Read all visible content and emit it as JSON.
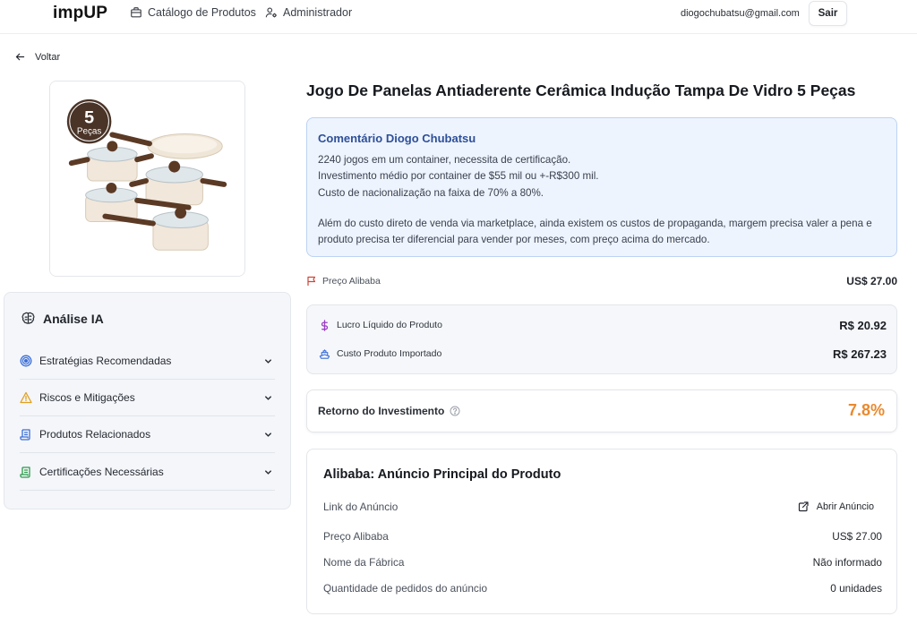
{
  "header": {
    "logo": "impUP",
    "nav": [
      {
        "label": "Catálogo de Produtos",
        "icon": "briefcase-icon"
      },
      {
        "label": "Administrador",
        "icon": "user-settings-icon"
      }
    ],
    "user_email": "diogochubatsu@gmail.com",
    "logout_label": "Sair"
  },
  "back": {
    "label": "Voltar",
    "icon": "arrow-left-icon"
  },
  "product": {
    "title": "Jogo De Panelas Antiaderente Cerâmica Indução Tampa De Vidro 5 Peças",
    "image_badge": {
      "number": "5",
      "word": "Peças"
    }
  },
  "ai_analysis": {
    "title": "Análise IA",
    "icon": "brain-icon",
    "sections": [
      {
        "label": "Estratégias Recomendadas",
        "icon": "target-icon",
        "color": "#3b6fd8"
      },
      {
        "label": "Riscos e Mitigações",
        "icon": "warning-icon",
        "color": "#e0a020"
      },
      {
        "label": "Produtos Relacionados",
        "icon": "scroll-icon",
        "color": "#3b6fd8"
      },
      {
        "label": "Certificações Necessárias",
        "icon": "scroll-icon",
        "color": "#2e9a4c"
      }
    ]
  },
  "comment": {
    "title": "Comentário Diogo Chubatsu",
    "lines": [
      "2240 jogos em um container, necessita de certificação.",
      "Investimento médio por container de $55 mil ou +-R$300 mil.",
      "Custo de nacionalização na faixa de 70% a 80%."
    ],
    "paragraph": "Além do custo direto de venda via marketplace, ainda existem os custos de propaganda, margem precisa valer a pena e produto precisa ter diferencial para vender por meses, com preço acima do mercado."
  },
  "pricing": {
    "alibaba_label": "Preço Alibaba",
    "alibaba_value": "US$ 27.00",
    "profit_label": "Lucro Líquido do Produto",
    "profit_value": "R$ 20.92",
    "cost_label": "Custo Produto Importado",
    "cost_value": "R$ 267.23",
    "roi_label": "Retorno do Investimento",
    "roi_value": "7.8%"
  },
  "listing": {
    "title": "Alibaba: Anúncio Principal do Produto",
    "link_label": "Link do Anúncio",
    "open_label": "Abrir Anúncio",
    "rows": [
      {
        "label": "Preço Alibaba",
        "value": "US$ 27.00"
      },
      {
        "label": "Nome da Fábrica",
        "value": "Não informado"
      },
      {
        "label": "Quantidade de pedidos do anúncio",
        "value": "0 unidades"
      }
    ]
  },
  "colors": {
    "accent_blue": "#2d4f9a",
    "roi_orange": "#e98a2e",
    "profit_purple": "#9b3fc4",
    "alert_red": "#d0443a"
  }
}
